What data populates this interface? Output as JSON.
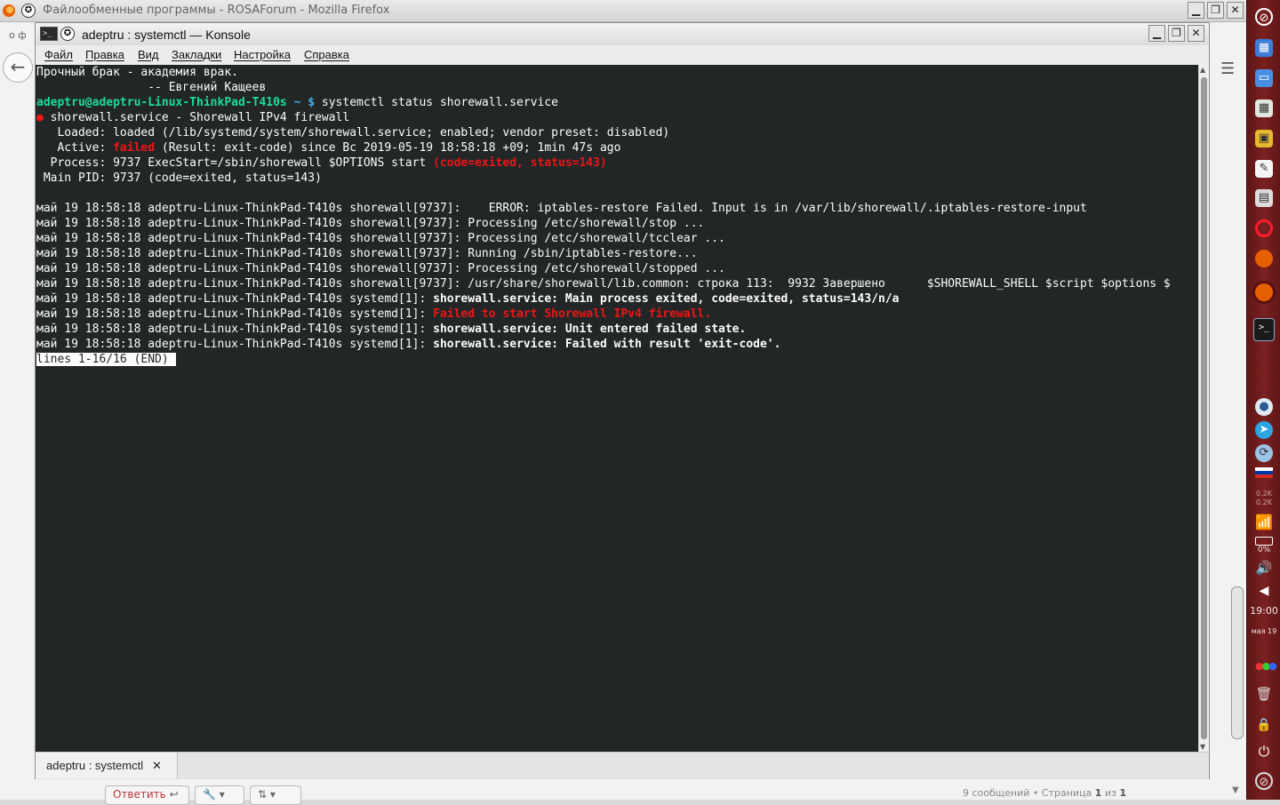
{
  "firefox": {
    "window_title": "Файлообменные программы - ROSAForum - Mozilla Firefox",
    "back_glyph": "←",
    "side_glyphs": "o ф",
    "menu_glyph": "☰",
    "bottom": {
      "reply_label": "Ответить",
      "info_prefix": "9 сообщений • Страница",
      "info_page": "1",
      "info_of": "из",
      "info_total": "1"
    }
  },
  "konsole": {
    "title": "adeptru : systemctl — Konsole",
    "menu": [
      "Файл",
      "Правка",
      "Вид",
      "Закладки",
      "Настройка",
      "Справка"
    ],
    "tab_label": "adeptru : systemctl",
    "tab_close": "✕",
    "terminal": {
      "quote_line1": "Прочный брак - академия врак.",
      "quote_line2": "                -- Евгений Кащеев",
      "prompt_user": "adeptru@adeptru-Linux-ThinkPad-T410s",
      "prompt_path": " ~ $",
      "command": " systemctl status shorewall.service",
      "status_dot": "●",
      "status_unit": " shorewall.service - Shorewall IPv4 firewall",
      "loaded_line": "   Loaded: loaded (/lib/systemd/system/shorewall.service; enabled; vendor preset: disabled)",
      "active_prefix": "   Active: ",
      "active_state": "failed",
      "active_rest": " (Result: exit-code) since Вс 2019-05-19 18:58:18 +09; 1min 47s ago",
      "process_prefix": "  Process: 9737 ExecStart=/sbin/shorewall $OPTIONS start ",
      "process_status": "(code=exited, status=143)",
      "mainpid_line": " Main PID: 9737 (code=exited, status=143)",
      "log_prefix": "май 19 18:58:18 adeptru-Linux-ThinkPad-T410s ",
      "log": [
        {
          "src": "shorewall[9737]: ",
          "msg": "   ERROR: iptables-restore Failed. Input is in /var/lib/shorewall/.iptables-restore-input",
          "style": "normal"
        },
        {
          "src": "shorewall[9737]: ",
          "msg": "Processing /etc/shorewall/stop ...",
          "style": "normal"
        },
        {
          "src": "shorewall[9737]: ",
          "msg": "Processing /etc/shorewall/tcclear ...",
          "style": "normal"
        },
        {
          "src": "shorewall[9737]: ",
          "msg": "Running /sbin/iptables-restore...",
          "style": "normal"
        },
        {
          "src": "shorewall[9737]: ",
          "msg": "Processing /etc/shorewall/stopped ...",
          "style": "normal"
        },
        {
          "src": "shorewall[9737]: ",
          "msg": "/usr/share/shorewall/lib.common: строка 113:  9932 Завершено      $SHOREWALL_SHELL $script $options $",
          "style": "normal"
        },
        {
          "src": "systemd[1]: ",
          "msg": "shorewall.service: Main process exited, code=exited, status=143/n/a",
          "style": "bold"
        },
        {
          "src": "systemd[1]: ",
          "msg": "Failed to start Shorewall IPv4 firewall.",
          "style": "red"
        },
        {
          "src": "systemd[1]: ",
          "msg": "shorewall.service: Unit entered failed state.",
          "style": "bold"
        },
        {
          "src": "systemd[1]: ",
          "msg": "shorewall.service: Failed with result 'exit-code'.",
          "style": "bold"
        }
      ],
      "pager_status": "lines 1-16/16 (END)"
    }
  },
  "dock": {
    "net_up": "0.2K",
    "net_down": "0.2K",
    "battery": "0%",
    "clock_time": "19:00",
    "clock_date": "мая 19"
  },
  "colors": {
    "terminal_bg": "#232627",
    "terminal_fg": "#fcfcfc",
    "prompt_green": "#1cdc9a",
    "prompt_blue": "#3daee9",
    "error_red": "#ed1515",
    "dock_red": "#7a2020"
  }
}
